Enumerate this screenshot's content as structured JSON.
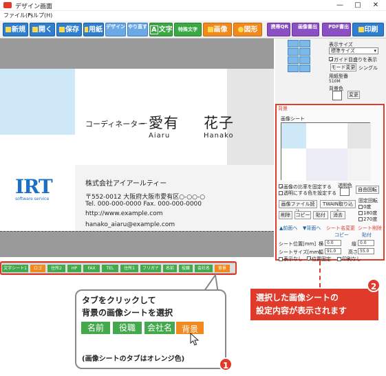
{
  "window": {
    "title": "デザイン画面",
    "minimize": "—",
    "maximize": "□",
    "close": "✕"
  },
  "menu": {
    "items": [
      "ファイル(F)",
      "ヘルプ(H)"
    ]
  },
  "toolbar": {
    "new": "新規",
    "open": "開く",
    "save": "保存",
    "paper": "用紙",
    "design_clear": "デザイン消去",
    "redo": "やり直す戻す",
    "text": "文字",
    "special_text": "特殊文字",
    "image": "画像",
    "shape": "図形",
    "mobile_qr": "携帯QR",
    "image_export": "画像書出",
    "pdf_export": "PDF書出",
    "print": "印刷"
  },
  "card": {
    "role": "コーディネーター",
    "surname": "愛有",
    "given": "花子",
    "roma_surname": "Aiaru",
    "roma_given": "Hanako",
    "company": "株式会社アイアールティー",
    "address": "〒552-0012 大阪府大阪市愛有区○-○○-○",
    "tel": "Tel. 000-000-0000 Fax. 000-000-0000",
    "url": "http://www.example.com",
    "email": "hanako_aiaru@example.com",
    "logo_text": "IRT",
    "logo_sub": "software service"
  },
  "tabs": [
    "文字シート1",
    "ロゴ",
    "住所2",
    "HP",
    "FAX",
    "TEL",
    "住所1",
    "フリガナ",
    "名前",
    "役職",
    "会社名",
    "背景"
  ],
  "settings": {
    "view_label": "表示サイズ",
    "view_value": "標準サイズ",
    "guide_label": "ガイド目盛りを表示",
    "mode_btn": "モード変更",
    "mode_value": "シングル",
    "paper_label": "用紙型番",
    "paper_value": "510M",
    "bgcolor_label": "背景色",
    "change_btn": "変更"
  },
  "bgpanel": {
    "title": "背景",
    "sheet_label": "画像シート",
    "keep_ratio": "画像の比率を固定する",
    "transparent_fill": "透明にする色を設定する",
    "transparent": "透明色",
    "free_rotate": "自由回転",
    "load": "画像ファイル読込",
    "twain": "TWAIN取り込み",
    "remove": "削除",
    "copy": "コピー",
    "paste": "貼付",
    "clear": "消去",
    "fixed_rotate": "固定回転",
    "r0": "0度",
    "r180": "180度",
    "r270": "270度",
    "front": "▲前面へ",
    "back": "▼背面へ",
    "rename": "シート名変更",
    "delete_sheet": "シート削除",
    "copy2": "コピー",
    "paste2": "貼付",
    "pos_label": "シート位置[mm]",
    "x_label": "横",
    "x_value": "0.0",
    "y_label": "縦",
    "y_value": "0.0",
    "size_label": "シートサイズ[mm]",
    "w_label": "幅",
    "w_value": "91.0",
    "h_label": "高さ",
    "h_value": "55.0",
    "hide": "表示なし",
    "fixed_pos": "位置固定",
    "no_print": "印刷なし"
  },
  "callout1": {
    "line1": "タブをクリックして",
    "line2": "背景の画像シートを選択",
    "tabs": [
      "名前",
      "役職",
      "会社名",
      "背景"
    ],
    "note": "(画像シートのタブはオレンジ色)",
    "num": "1"
  },
  "callout2": {
    "line1": "選択した画像シートの",
    "line2": "設定内容が表示されます",
    "num": "2"
  }
}
